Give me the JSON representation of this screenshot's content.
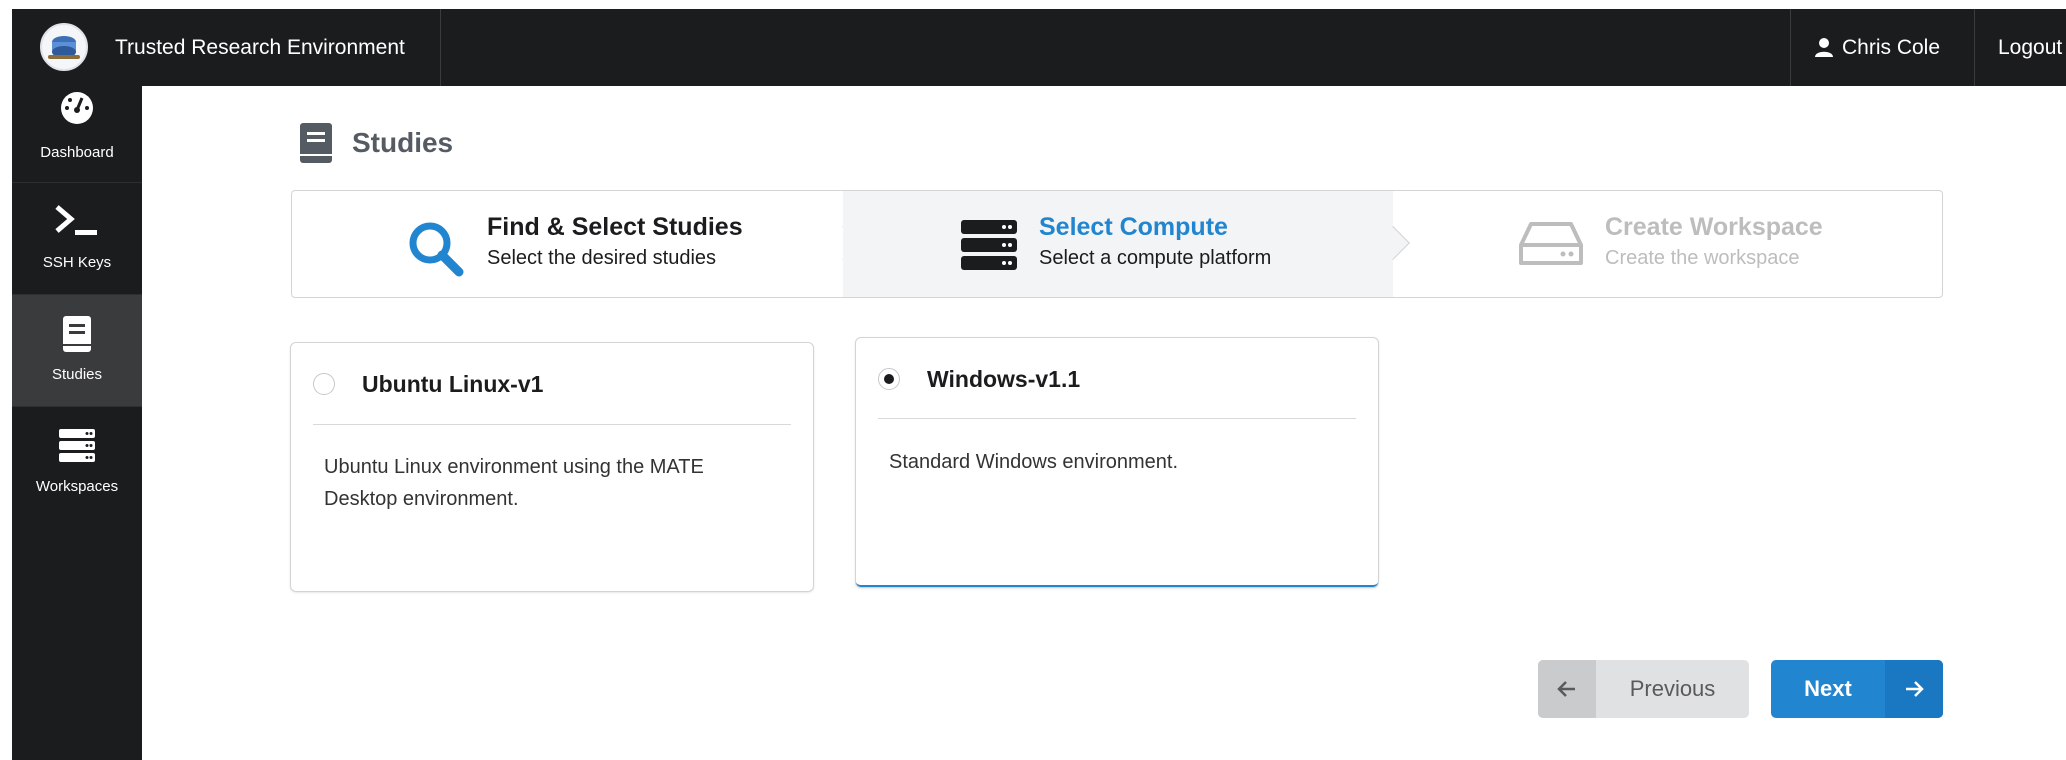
{
  "app": {
    "title": "Trusted Research Environment",
    "user_name": "Chris Cole",
    "logout_label": "Logout"
  },
  "sidebar": {
    "items": [
      {
        "label": "Dashboard",
        "icon": "dashboard-gauge-icon",
        "active": false
      },
      {
        "label": "SSH Keys",
        "icon": "terminal-prompt-icon",
        "active": false
      },
      {
        "label": "Studies",
        "icon": "book-icon",
        "active": true
      },
      {
        "label": "Workspaces",
        "icon": "server-icon",
        "active": false
      }
    ]
  },
  "page": {
    "title": "Studies",
    "title_icon": "book-icon"
  },
  "steps": [
    {
      "title": "Find & Select Studies",
      "description": "Select the desired studies",
      "icon": "search-icon",
      "state": "completed"
    },
    {
      "title": "Select Compute",
      "description": "Select a compute platform",
      "icon": "server-icon",
      "state": "active"
    },
    {
      "title": "Create Workspace",
      "description": "Create the workspace",
      "icon": "hdd-icon",
      "state": "disabled"
    }
  ],
  "compute_options": [
    {
      "title": "Ubuntu Linux-v1",
      "description": "Ubuntu Linux environment using the MATE Desktop environment.",
      "selected": false
    },
    {
      "title": "Windows-v1.1",
      "description": "Standard Windows environment.",
      "selected": true
    }
  ],
  "buttons": {
    "previous_label": "Previous",
    "next_label": "Next"
  },
  "colors": {
    "primary": "#2185d0",
    "topbar": "#1b1c1d",
    "sidebar_active": "#3a3b3c",
    "disabled_text": "#bdbdbd"
  }
}
